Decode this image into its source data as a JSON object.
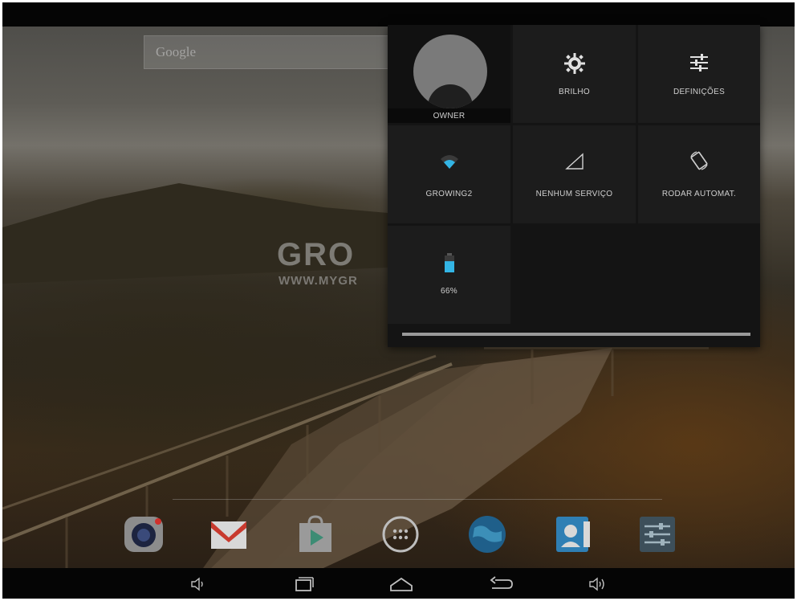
{
  "search": {
    "placeholder": "Google"
  },
  "watermark": {
    "title": "GRO",
    "url": "WWW.MYGR"
  },
  "quick_settings": {
    "owner_label": "OWNER",
    "brightness_label": "BRILHO",
    "settings_label": "DEFINIÇÕES",
    "wifi_label": "GROWING2",
    "signal_label": "NENHUM SERVIÇO",
    "rotate_label": "RODAR AUTOMAT.",
    "battery_label": "66%",
    "battery_level": 0.66,
    "progress_level": 1.0
  },
  "dock": {
    "apps": [
      "camera-icon",
      "gmail-icon",
      "play-store-icon",
      "app-drawer-icon",
      "browser-globe-icon",
      "contacts-icon",
      "settings-app-icon"
    ]
  },
  "navbar": {
    "buttons": [
      "volume-down-icon",
      "recent-apps-icon",
      "home-icon",
      "back-icon",
      "volume-up-icon"
    ]
  },
  "colors": {
    "wifi_accent": "#33b5e5",
    "battery_accent": "#33b5e5",
    "panel_bg": "#141414",
    "tile_bg": "#1c1c1c"
  }
}
